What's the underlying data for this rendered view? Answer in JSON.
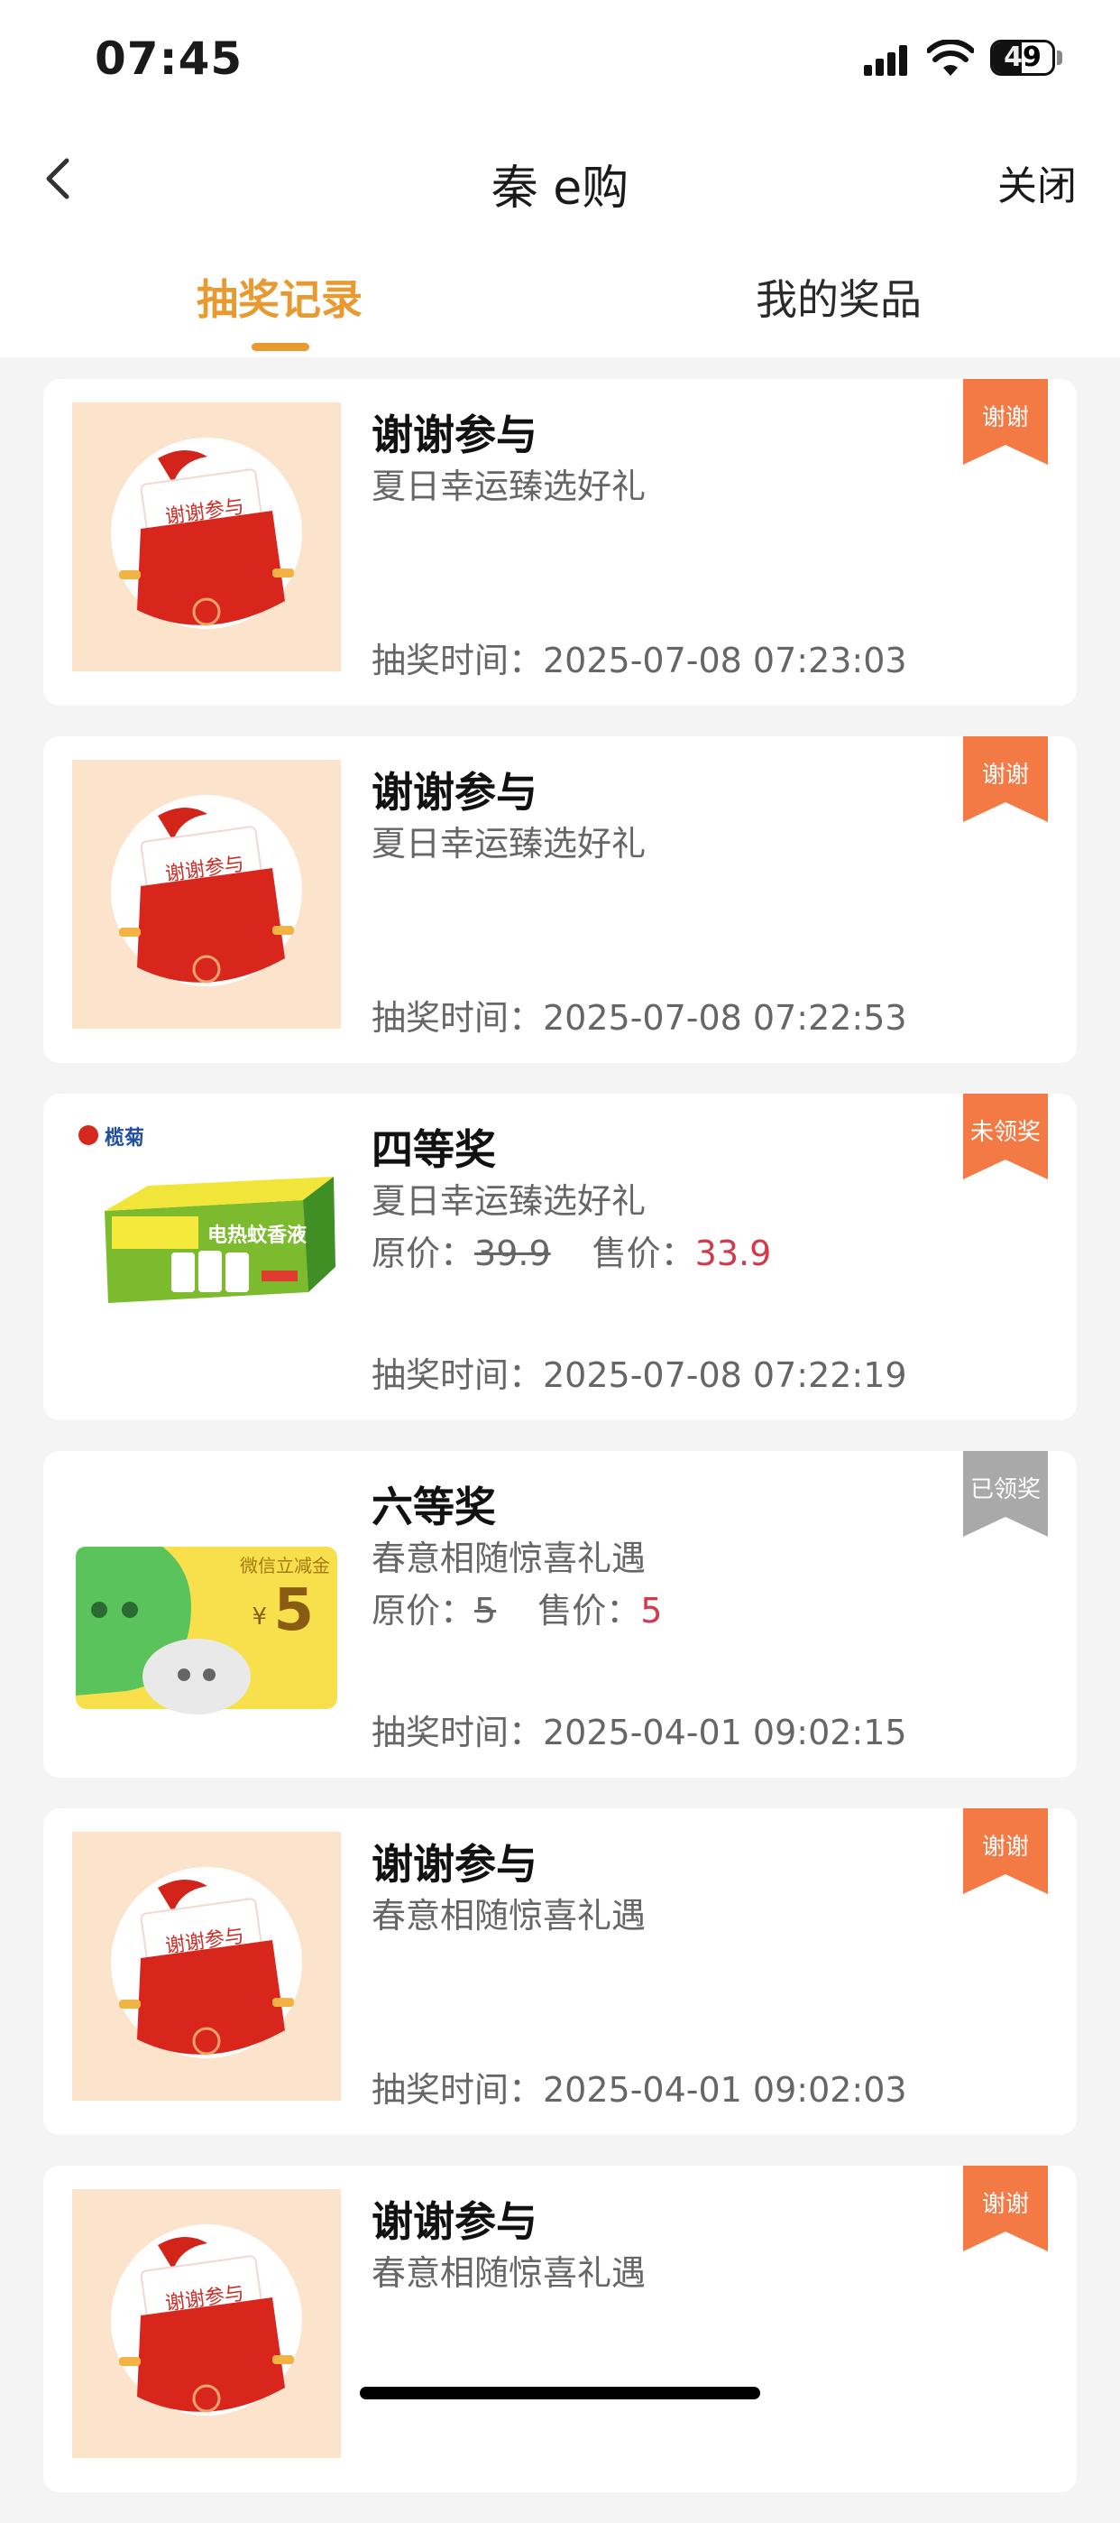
{
  "status_bar": {
    "time": "07:45",
    "battery": "49",
    "battery_level": 0.49
  },
  "nav": {
    "title": "秦 e购",
    "close_label": "关闭"
  },
  "tabs": [
    {
      "label": "抽奖记录",
      "active": true
    },
    {
      "label": "我的奖品",
      "active": false
    }
  ],
  "records": [
    {
      "title": "谢谢参与",
      "activity": "夏日幸运臻选好礼",
      "time": "抽奖时间：2025-07-08 07:23:03",
      "badge": "谢谢",
      "thumb_text": "谢谢参与"
    },
    {
      "title": "谢谢参与",
      "activity": "夏日幸运臻选好礼",
      "time": "抽奖时间：2025-07-08 07:22:53",
      "badge": "谢谢",
      "thumb_text": "谢谢参与"
    },
    {
      "title": "四等奖",
      "activity": "夏日幸运臻选好礼",
      "orig_label": "原价：",
      "orig_price": "39.9",
      "sale_label": "售价：",
      "sale_price": "33.9",
      "time": "抽奖时间：2025-07-08 07:22:19",
      "badge": "未领奖",
      "brand": "榄菊",
      "product_text": "电热蚊香液"
    },
    {
      "title": "六等奖",
      "activity": "春意相随惊喜礼遇",
      "orig_label": "原价：",
      "orig_price": "5",
      "sale_label": "售价：",
      "sale_price": "5",
      "time": "抽奖时间：2025-04-01 09:02:15",
      "badge": "已领奖",
      "coupon_label": "微信立减金",
      "coupon_currency": "¥",
      "coupon_value": "5"
    },
    {
      "title": "谢谢参与",
      "activity": "春意相随惊喜礼遇",
      "time": "抽奖时间：2025-04-01 09:02:03",
      "badge": "谢谢",
      "thumb_text": "谢谢参与"
    },
    {
      "title": "谢谢参与",
      "activity": "春意相随惊喜礼遇",
      "badge": "谢谢",
      "thumb_text": "谢谢参与"
    }
  ],
  "colors": {
    "accent": "#e79a30",
    "badge_orange": "#f47a45",
    "badge_gray": "#a9a9a9",
    "sale_price": "#d2394a",
    "thumb_bg": "#fce3cc"
  }
}
